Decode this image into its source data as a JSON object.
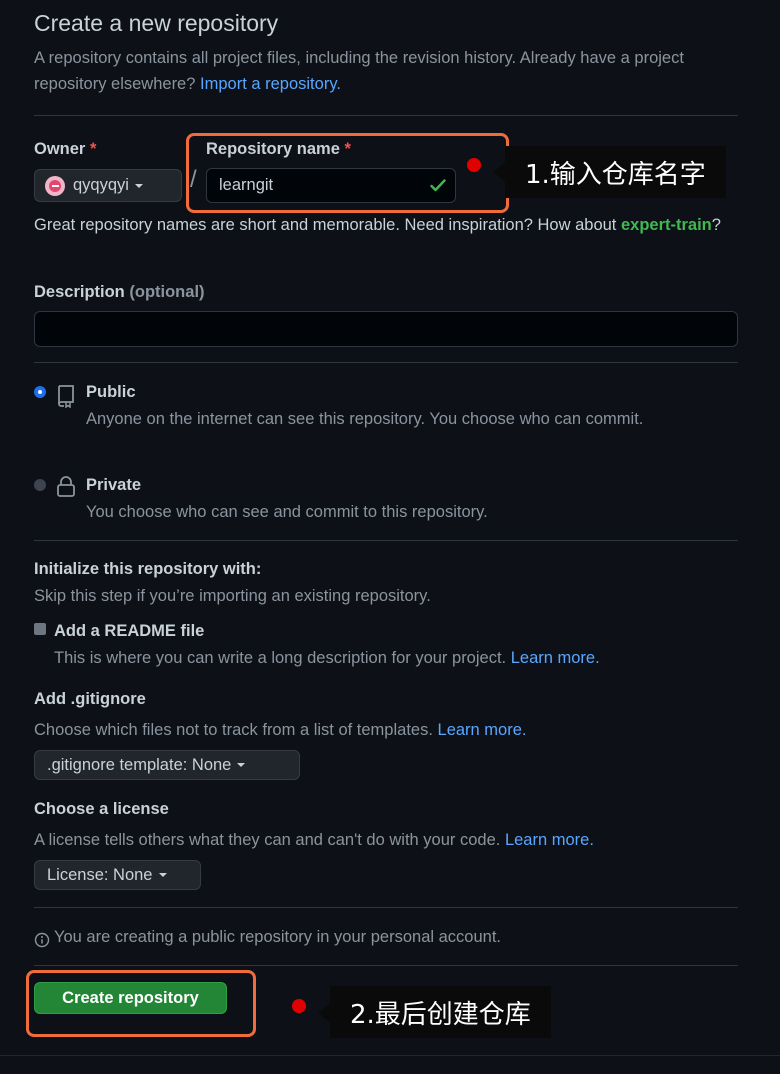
{
  "header": {
    "title": "Create a new repository",
    "subtitle": "A repository contains all project files, including the revision history. Already have a project repository elsewhere?",
    "import_link": "Import a repository."
  },
  "owner": {
    "label": "Owner",
    "required_mark": "*",
    "value": "qyqyqyi"
  },
  "separator": "/",
  "repo_name": {
    "label": "Repository name",
    "required_mark": "*",
    "value": "learngit",
    "hint_prefix": "Great repository names are short and memorable. Need inspiration? How about",
    "suggestion": "expert-train",
    "hint_suffix": "?"
  },
  "description": {
    "label": "Description",
    "optional": "(optional)",
    "value": ""
  },
  "visibility": {
    "public": {
      "title": "Public",
      "desc": "Anyone on the internet can see this repository. You choose who can commit.",
      "selected": true
    },
    "private": {
      "title": "Private",
      "desc": "You choose who can see and commit to this repository.",
      "selected": false
    }
  },
  "initialize": {
    "heading": "Initialize this repository with:",
    "subtext": "Skip this step if you’re importing an existing repository.",
    "readme_title": "Add a README file",
    "readme_desc": "This is where you can write a long description for your project.",
    "readme_link": "Learn more."
  },
  "gitignore": {
    "heading": "Add .gitignore",
    "desc": "Choose which files not to track from a list of templates.",
    "link": "Learn more.",
    "select": ".gitignore template: None"
  },
  "license": {
    "heading": "Choose a license",
    "desc": "A license tells others what they can and can't do with your code.",
    "link": "Learn more.",
    "select": "License: None"
  },
  "notice": "You are creating a public repository in your personal account.",
  "submit": "Create repository",
  "annotations": {
    "step1": "1.输入仓库名字",
    "step2": "2.最后创建仓库"
  },
  "colors": {
    "background": "#0d1117",
    "link": "#58a6ff",
    "suggestion": "#3fb950",
    "primary_button": "#238636",
    "highlight_box": "#f26b3a",
    "marker": "#e00000"
  },
  "icons": {
    "valid": "check-icon",
    "public": "repo-icon",
    "private": "lock-icon",
    "notice": "info-icon"
  }
}
